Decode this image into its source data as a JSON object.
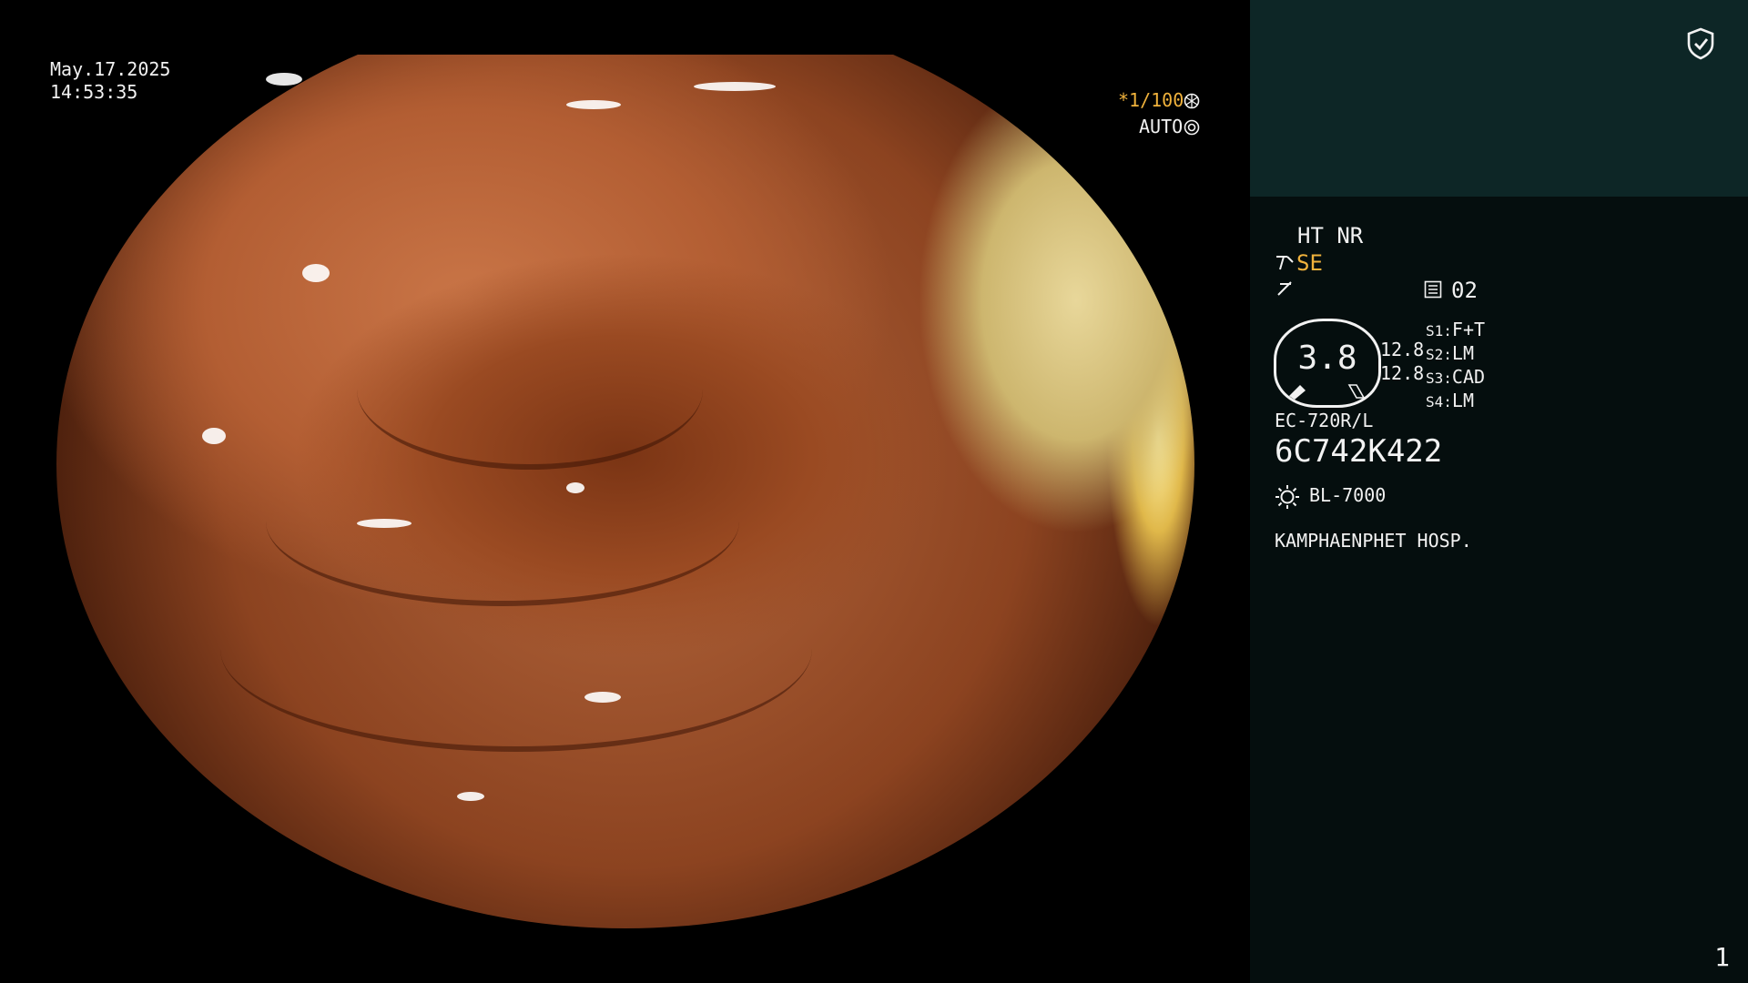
{
  "overlay": {
    "date": "May.17.2025",
    "time": "14:53:35",
    "shutter": "*1/100",
    "auto": "AUTO"
  },
  "panel": {
    "mode": "HT NR",
    "se": "SE",
    "channel": "02",
    "gauge_value": "3.8",
    "readout_top": "12.8",
    "readout_bottom": "12.8",
    "s_settings": [
      {
        "key": "S1:",
        "value": "F+T"
      },
      {
        "key": "S2:",
        "value": "LM"
      },
      {
        "key": "S3:",
        "value": "CAD"
      },
      {
        "key": "S4:",
        "value": "LM"
      }
    ],
    "scope_model": "EC-720R/L",
    "serial": "6C742K422",
    "light_source": "BL-7000",
    "hospital": "KAMPHAENPHET HOSP.",
    "page_number": "1"
  },
  "icons": [
    "shield-check-icon",
    "aperture-icon",
    "auto-iris-icon",
    "scope-tip-icon",
    "freeze-icon",
    "memory-icon",
    "light-source-icon"
  ],
  "colors": {
    "shutter": "#f0b23c",
    "panel_top": "#0d2626",
    "panel_bg": "#050e0e"
  }
}
